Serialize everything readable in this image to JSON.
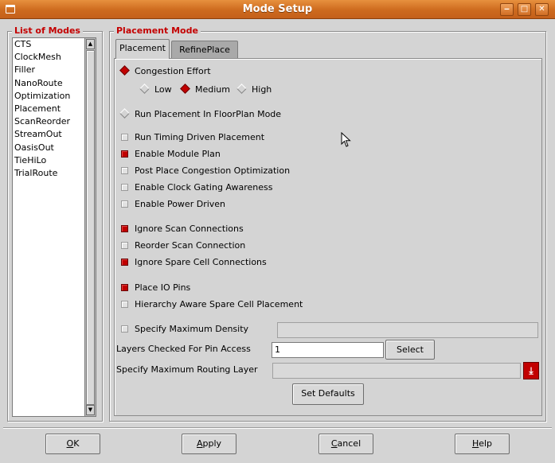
{
  "window": {
    "title": "Mode Setup",
    "title_bar_color": "#cd6a1e",
    "icons": [
      "window-menu-icon",
      "minimize-icon",
      "maximize-icon",
      "close-icon"
    ]
  },
  "modes": {
    "title": "List of Modes",
    "items": [
      "CTS",
      "ClockMesh",
      "Filler",
      "NanoRoute",
      "Optimization",
      "Placement",
      "ScanReorder",
      "StreamOut",
      "OasisOut",
      "TieHiLo",
      "TrialRoute"
    ]
  },
  "placement": {
    "title": "Placement Mode",
    "tabs": [
      {
        "label": "Placement",
        "active": true
      },
      {
        "label": "RefinePlace",
        "active": false
      }
    ],
    "congestion_effort": {
      "label": "Congestion Effort",
      "options": [
        {
          "label": "Low",
          "selected": false
        },
        {
          "label": "Medium",
          "selected": true
        },
        {
          "label": "High",
          "selected": false
        }
      ]
    },
    "floorplan_mode": {
      "label": "Run Placement In FloorPlan Mode",
      "selected": false
    },
    "checks": [
      {
        "label": "Run Timing Driven Placement",
        "checked": false
      },
      {
        "label": "Enable Module Plan",
        "checked": true
      },
      {
        "label": "Post Place Congestion Optimization",
        "checked": false
      },
      {
        "label": "Enable Clock Gating Awareness",
        "checked": false
      },
      {
        "label": "Enable Power Driven",
        "checked": false
      },
      {
        "label": "Ignore Scan Connections",
        "checked": true
      },
      {
        "label": "Reorder Scan Connection",
        "checked": false
      },
      {
        "label": "Ignore Spare Cell Connections",
        "checked": true
      },
      {
        "label": "Place IO Pins",
        "checked": true
      },
      {
        "label": "Hierarchy Aware Spare Cell Placement",
        "checked": false
      }
    ],
    "max_density": {
      "label": "Specify Maximum Density",
      "checked": false,
      "value": ""
    },
    "pin_access": {
      "label": "Layers Checked For Pin Access",
      "value": "1",
      "button": "Select"
    },
    "max_routing": {
      "label": "Specify Maximum Routing Layer",
      "value": ""
    },
    "set_defaults": "Set Defaults"
  },
  "footer": {
    "ok": {
      "text": "OK",
      "mnemonic": "O",
      "rest": "K"
    },
    "apply": {
      "text": "Apply",
      "mnemonic": "A",
      "rest": "pply"
    },
    "cancel": {
      "text": "Cancel",
      "mnemonic": "C",
      "rest": "ancel"
    },
    "help": {
      "text": "Help",
      "mnemonic": "H",
      "rest": "elp"
    }
  },
  "colors": {
    "accent": "#c40000",
    "checked": "#c10000",
    "background": "#d4d4d4"
  }
}
